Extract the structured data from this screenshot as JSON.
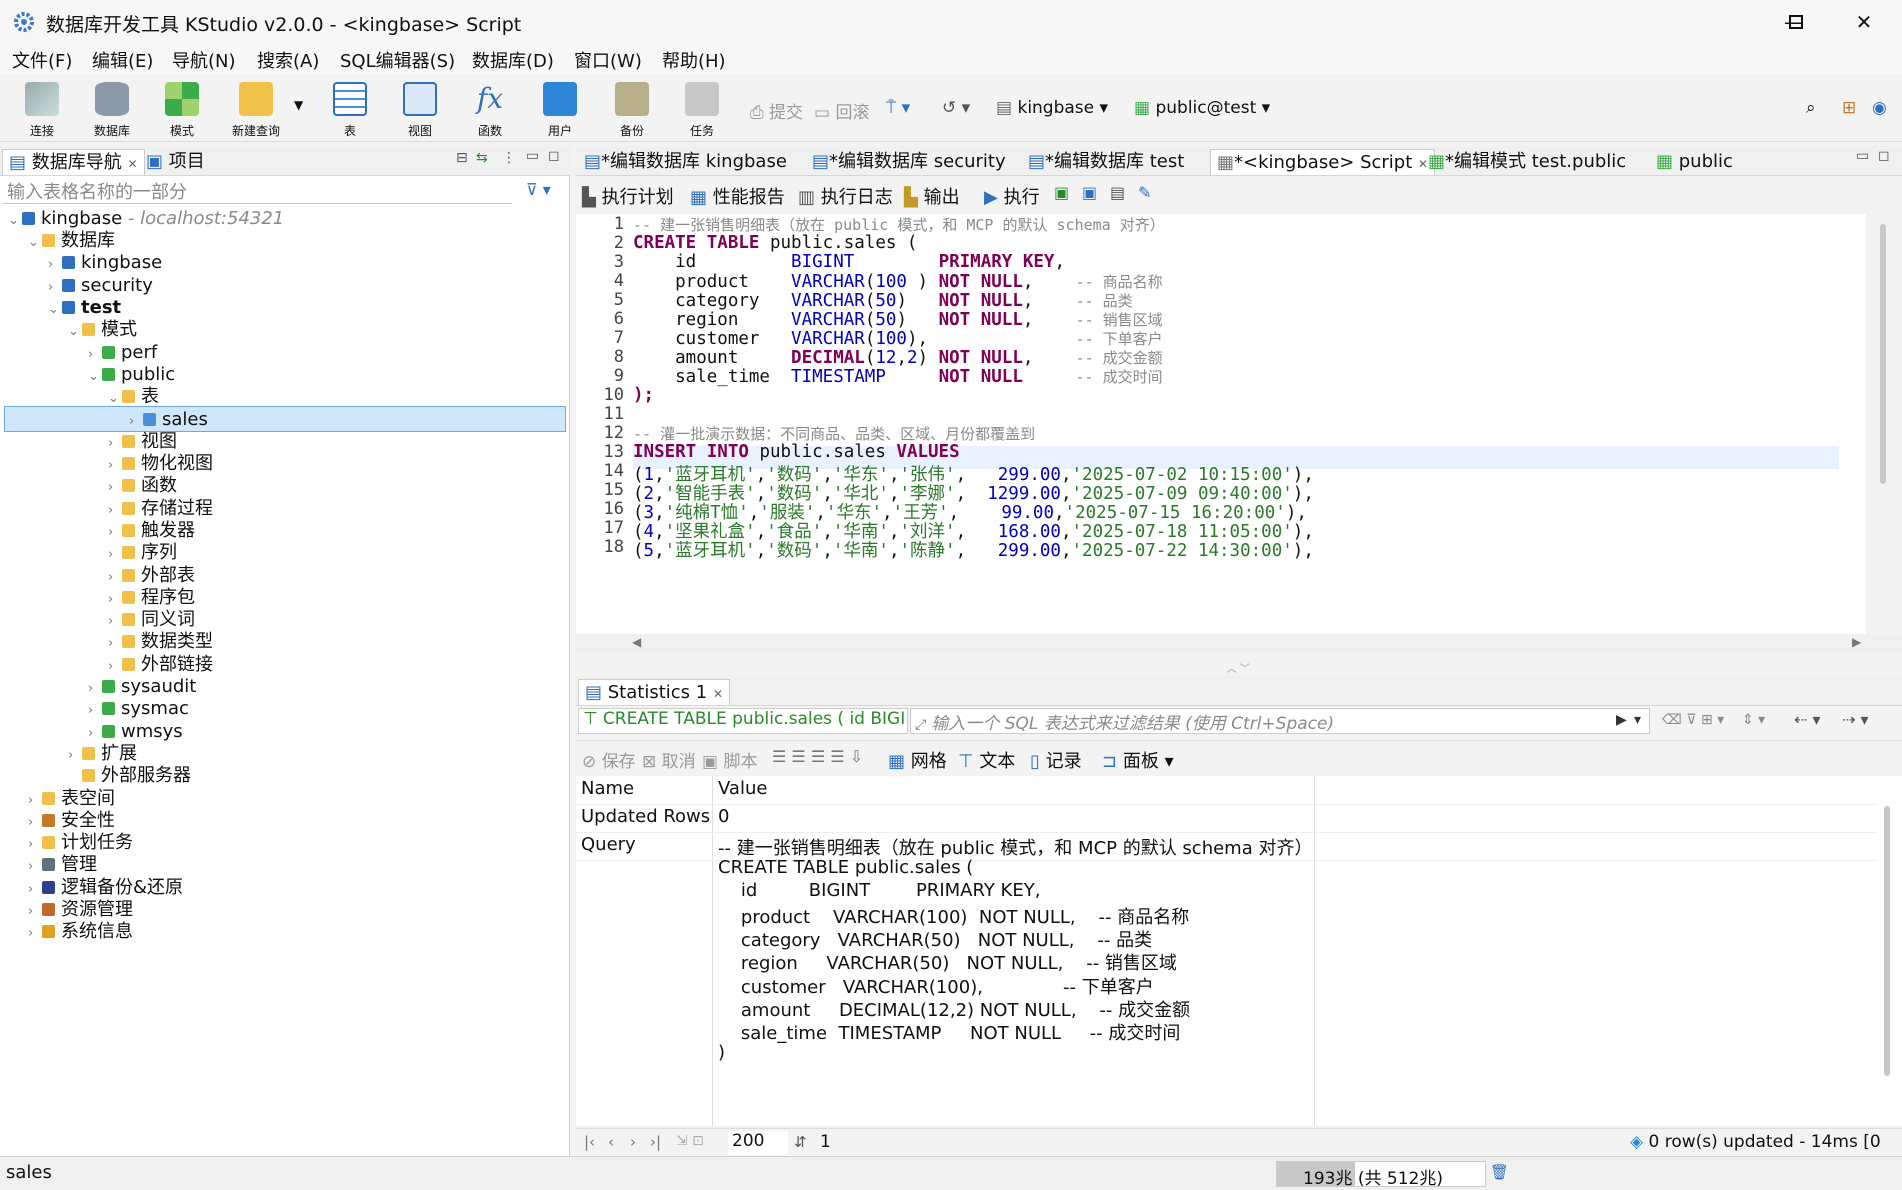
{
  "window": {
    "title": "数据库开发工具 KStudio v2.0.0 - <kingbase> Script"
  },
  "menu": [
    "文件(F)",
    "编辑(E)",
    "导航(N)",
    "搜索(A)",
    "SQL编辑器(S)",
    "数据库(D)",
    "窗口(W)",
    "帮助(H)"
  ],
  "toolbar": {
    "buttons": [
      "连接",
      "数据库",
      "模式",
      "新建查询",
      "表",
      "视图",
      "函数",
      "用户",
      "备份",
      "任务"
    ],
    "commit": "提交",
    "rollback": "回滚",
    "connection": "kingbase",
    "schema": "public@test"
  },
  "nav": {
    "tabs": [
      "数据库导航",
      "项目"
    ],
    "filter_placeholder": "输入表格名称的一部分",
    "root": "kingbase",
    "root_host": "- localhost:54321",
    "tree": [
      {
        "label": "数据库",
        "level": 1,
        "icon": "folder-icon",
        "expanded": true
      },
      {
        "label": "kingbase",
        "level": 2,
        "icon": "database-icon"
      },
      {
        "label": "security",
        "level": 2,
        "icon": "database-icon"
      },
      {
        "label": "test",
        "level": 2,
        "icon": "database-icon",
        "expanded": true,
        "bold": true
      },
      {
        "label": "模式",
        "level": 3,
        "icon": "folder-icon",
        "expanded": true
      },
      {
        "label": "perf",
        "level": 4,
        "icon": "schema-icon"
      },
      {
        "label": "public",
        "level": 4,
        "icon": "schema-icon",
        "expanded": true
      },
      {
        "label": "表",
        "level": 5,
        "icon": "folder-icon",
        "expanded": true
      },
      {
        "label": "sales",
        "level": 6,
        "icon": "table-icon",
        "selected": true
      },
      {
        "label": "视图",
        "level": 5,
        "icon": "folder-icon"
      },
      {
        "label": "物化视图",
        "level": 5,
        "icon": "folder-icon"
      },
      {
        "label": "函数",
        "level": 5,
        "icon": "folder-icon"
      },
      {
        "label": "存储过程",
        "level": 5,
        "icon": "folder-icon"
      },
      {
        "label": "触发器",
        "level": 5,
        "icon": "folder-icon"
      },
      {
        "label": "序列",
        "level": 5,
        "icon": "folder-icon"
      },
      {
        "label": "外部表",
        "level": 5,
        "icon": "folder-icon"
      },
      {
        "label": "程序包",
        "level": 5,
        "icon": "folder-icon"
      },
      {
        "label": "同义词",
        "level": 5,
        "icon": "folder-icon"
      },
      {
        "label": "数据类型",
        "level": 5,
        "icon": "folder-icon"
      },
      {
        "label": "外部链接",
        "level": 5,
        "icon": "folder-icon"
      },
      {
        "label": "sysaudit",
        "level": 4,
        "icon": "schema-icon"
      },
      {
        "label": "sysmac",
        "level": 4,
        "icon": "schema-icon"
      },
      {
        "label": "wmsys",
        "level": 4,
        "icon": "schema-icon"
      },
      {
        "label": "扩展",
        "level": 3,
        "icon": "folder-icon"
      },
      {
        "label": "外部服务器",
        "level": 3,
        "icon": "folder-icon",
        "noarrow": true
      },
      {
        "label": "表空间",
        "level": 1,
        "icon": "folder-icon"
      },
      {
        "label": "安全性",
        "level": 1,
        "icon": "security-icon"
      },
      {
        "label": "计划任务",
        "level": 1,
        "icon": "folder-icon"
      },
      {
        "label": "管理",
        "level": 1,
        "icon": "gear-icon"
      },
      {
        "label": "逻辑备份&还原",
        "level": 1,
        "icon": "backup-icon"
      },
      {
        "label": "资源管理",
        "level": 1,
        "icon": "resource-icon"
      },
      {
        "label": "系统信息",
        "level": 1,
        "icon": "info-icon"
      }
    ]
  },
  "editor_tabs": [
    "*编辑数据库 kingbase",
    "*编辑数据库 security",
    "*编辑数据库 test",
    "*<kingbase> Script",
    "*编辑模式 test.public",
    "public"
  ],
  "editor_actions": [
    "执行计划",
    "性能报告",
    "执行日志",
    "输出",
    "执行"
  ],
  "code_lines": [
    {
      "n": "1",
      "segs": [
        [
          "cm",
          "-- 建一张销售明细表（放在 public 模式，和 MCP 的默认 schema 对齐）"
        ]
      ]
    },
    {
      "n": "2",
      "segs": [
        [
          "kw",
          "CREATE TABLE "
        ],
        [
          "",
          "public.sales ("
        ]
      ]
    },
    {
      "n": "3",
      "segs": [
        [
          "",
          "    id         "
        ],
        [
          "ty",
          "BIGINT        "
        ],
        [
          "kw",
          "PRIMARY KEY"
        ],
        [
          "",
          ","
        ]
      ]
    },
    {
      "n": "4",
      "segs": [
        [
          "",
          "    product    "
        ],
        [
          "ty",
          "VARCHAR"
        ],
        [
          "",
          "("
        ],
        [
          "nm",
          "100"
        ],
        [
          "",
          " ) "
        ],
        [
          "kw",
          "NOT NULL"
        ],
        [
          "",
          ",    "
        ],
        [
          "cm",
          "-- 商品名称"
        ]
      ]
    },
    {
      "n": "5",
      "segs": [
        [
          "",
          "    category   "
        ],
        [
          "ty",
          "VARCHAR"
        ],
        [
          "",
          "("
        ],
        [
          "nm",
          "50"
        ],
        [
          "",
          ")   "
        ],
        [
          "kw",
          "NOT NULL"
        ],
        [
          "",
          ",    "
        ],
        [
          "cm",
          "-- 品类"
        ]
      ]
    },
    {
      "n": "6",
      "segs": [
        [
          "",
          "    region     "
        ],
        [
          "ty",
          "VARCHAR"
        ],
        [
          "",
          "("
        ],
        [
          "nm",
          "50"
        ],
        [
          "",
          ")   "
        ],
        [
          "kw",
          "NOT NULL"
        ],
        [
          "",
          ",    "
        ],
        [
          "cm",
          "-- 销售区域"
        ]
      ]
    },
    {
      "n": "7",
      "segs": [
        [
          "",
          "    customer   "
        ],
        [
          "ty",
          "VARCHAR"
        ],
        [
          "",
          "("
        ],
        [
          "nm",
          "100"
        ],
        [
          "",
          "),              "
        ],
        [
          "cm",
          "-- 下单客户"
        ]
      ]
    },
    {
      "n": "8",
      "segs": [
        [
          "",
          "    amount     "
        ],
        [
          "kw",
          "DECIMAL"
        ],
        [
          "",
          "("
        ],
        [
          "nm",
          "12"
        ],
        [
          "",
          ","
        ],
        [
          "nm",
          "2"
        ],
        [
          "",
          ") "
        ],
        [
          "kw",
          "NOT NULL"
        ],
        [
          "",
          ",    "
        ],
        [
          "cm",
          "-- 成交金额"
        ]
      ]
    },
    {
      "n": "9",
      "segs": [
        [
          "",
          "    sale_time  "
        ],
        [
          "ty",
          "TIMESTAMP     "
        ],
        [
          "kw",
          "NOT NULL     "
        ],
        [
          "cm",
          "-- 成交时间"
        ]
      ]
    },
    {
      "n": "10",
      "segs": [
        [
          "kw",
          ");"
        ]
      ]
    },
    {
      "n": "11",
      "segs": [
        [
          "",
          ""
        ]
      ]
    },
    {
      "n": "12",
      "segs": [
        [
          "cm",
          "-- 灌一批演示数据：不同商品、品类、区域、月份都覆盖到"
        ]
      ]
    },
    {
      "n": "13",
      "segs": [
        [
          "kw",
          "INSERT INTO "
        ],
        [
          "",
          "public.sales "
        ],
        [
          "kw",
          "VALUES"
        ]
      ]
    },
    {
      "n": "14",
      "segs": [
        [
          "",
          ""
        ],
        [
          "",
          ""
        ],
        [
          "",
          "("
        ],
        [
          "nm",
          "1"
        ],
        [
          "",
          ","
        ],
        [
          "st",
          "'蓝牙耳机'"
        ],
        [
          "",
          ","
        ],
        [
          "st",
          "'数码'"
        ],
        [
          "",
          ","
        ],
        [
          "st",
          "'华东'"
        ],
        [
          "",
          ","
        ],
        [
          "st",
          "'张伟'"
        ],
        [
          "",
          ",   "
        ],
        [
          "nm",
          "299.00"
        ],
        [
          "",
          ","
        ],
        [
          "st",
          "'2025-07-02 10:15:00'"
        ],
        [
          "",
          "),"
        ]
      ]
    },
    {
      "n": "15",
      "segs": [
        [
          "",
          "("
        ],
        [
          "nm",
          "2"
        ],
        [
          "",
          ","
        ],
        [
          "st",
          "'智能手表'"
        ],
        [
          "",
          ","
        ],
        [
          "st",
          "'数码'"
        ],
        [
          "",
          ","
        ],
        [
          "st",
          "'华北'"
        ],
        [
          "",
          ","
        ],
        [
          "st",
          "'李娜'"
        ],
        [
          "",
          ",  "
        ],
        [
          "nm",
          "1299.00"
        ],
        [
          "",
          ","
        ],
        [
          "st",
          "'2025-07-09 09:40:00'"
        ],
        [
          "",
          "),"
        ]
      ]
    },
    {
      "n": "16",
      "segs": [
        [
          "",
          "("
        ],
        [
          "nm",
          "3"
        ],
        [
          "",
          ","
        ],
        [
          "st",
          "'纯棉T恤'"
        ],
        [
          "",
          ","
        ],
        [
          "st",
          "'服装'"
        ],
        [
          "",
          ","
        ],
        [
          "st",
          "'华东'"
        ],
        [
          "",
          ","
        ],
        [
          "st",
          "'王芳'"
        ],
        [
          "",
          ",    "
        ],
        [
          "nm",
          "99.00"
        ],
        [
          "",
          ","
        ],
        [
          "st",
          "'2025-07-15 16:20:00'"
        ],
        [
          "",
          "),"
        ]
      ]
    },
    {
      "n": "17",
      "segs": [
        [
          "",
          "("
        ],
        [
          "nm",
          "4"
        ],
        [
          "",
          ","
        ],
        [
          "st",
          "'坚果礼盒'"
        ],
        [
          "",
          ","
        ],
        [
          "st",
          "'食品'"
        ],
        [
          "",
          ","
        ],
        [
          "st",
          "'华南'"
        ],
        [
          "",
          ","
        ],
        [
          "st",
          "'刘洋'"
        ],
        [
          "",
          ",   "
        ],
        [
          "nm",
          "168.00"
        ],
        [
          "",
          ","
        ],
        [
          "st",
          "'2025-07-18 11:05:00'"
        ],
        [
          "",
          "),"
        ]
      ]
    },
    {
      "n": "18",
      "segs": [
        [
          "",
          "("
        ],
        [
          "nm",
          "5"
        ],
        [
          "",
          ","
        ],
        [
          "st",
          "'蓝牙耳机'"
        ],
        [
          "",
          ","
        ],
        [
          "st",
          "'数码'"
        ],
        [
          "",
          ","
        ],
        [
          "st",
          "'华南'"
        ],
        [
          "",
          ","
        ],
        [
          "st",
          "'陈静'"
        ],
        [
          "",
          ",   "
        ],
        [
          "nm",
          "299.00"
        ],
        [
          "",
          ","
        ],
        [
          "st",
          "'2025-07-22 14:30:00'"
        ],
        [
          "",
          "),"
        ]
      ]
    }
  ],
  "results": {
    "tab": "Statistics 1",
    "query_preview": "CREATE TABLE public.sales ( id BIGI",
    "filter_placeholder": "输入一个 SQL 表达式来过滤结果 (使用 Ctrl+Space)",
    "actions": [
      "保存",
      "取消",
      "脚本"
    ],
    "views": [
      "网格",
      "文本",
      "记录",
      "面板"
    ],
    "headers": [
      "Name",
      "Value"
    ],
    "rows": [
      {
        "name": "Updated Rows",
        "value": "0"
      },
      {
        "name": "Query",
        "value": "-- 建一张销售明细表（放在 public 模式，和 MCP 的默认 schema 对齐）"
      }
    ],
    "query_lines": [
      "CREATE TABLE public.sales (",
      "    id         BIGINT        PRIMARY KEY,",
      "    product    VARCHAR(100)  NOT NULL,    -- 商品名称",
      "    category   VARCHAR(50)   NOT NULL,    -- 品类",
      "    region     VARCHAR(50)   NOT NULL,    -- 销售区域",
      "    customer   VARCHAR(100),              -- 下单客户",
      "    amount     DECIMAL(12,2) NOT NULL,    -- 成交金额",
      "    sale_time  TIMESTAMP     NOT NULL     -- 成交时间",
      ")"
    ],
    "fetch_size": "200",
    "page": "1",
    "status": "0 row(s) updated - 14ms [0"
  },
  "status": {
    "left": "sales",
    "memory": "193兆 (共 512兆)"
  }
}
